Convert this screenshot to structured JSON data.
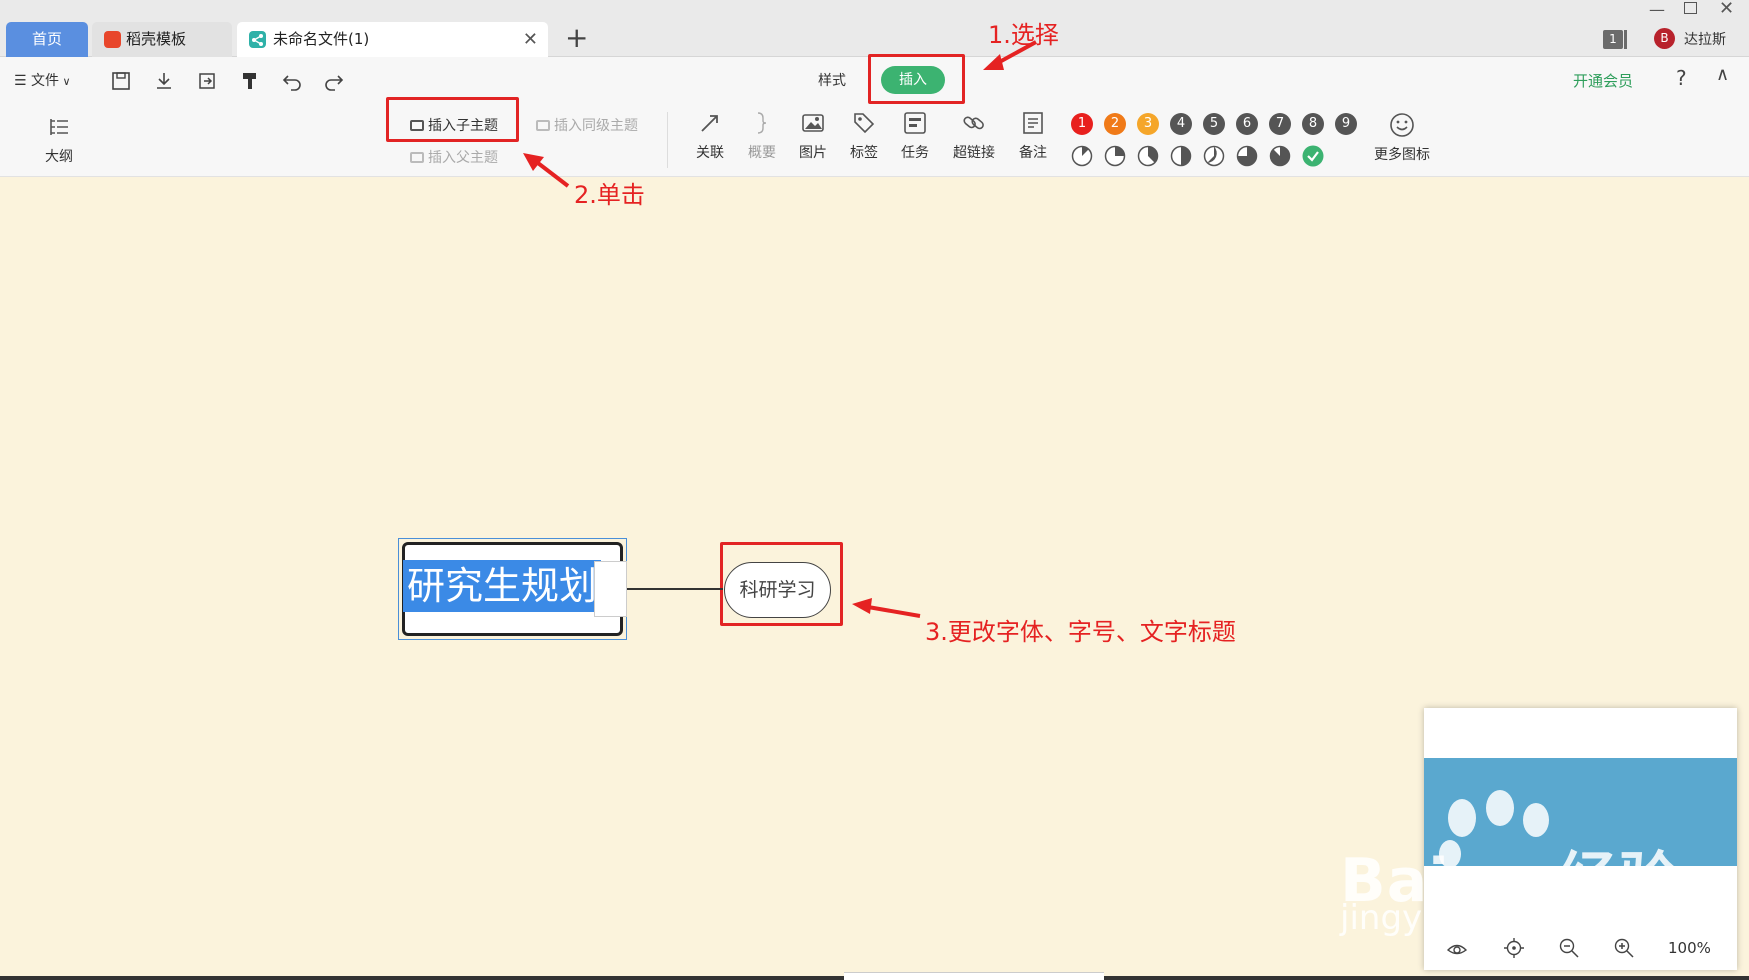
{
  "tabs": {
    "home": "首页",
    "templates": "稻壳模板",
    "file": "未命名文件(1)"
  },
  "window": {
    "page_count": "1",
    "user_name": "达拉斯",
    "user_avatar_char": "B"
  },
  "toolbar": {
    "file_menu": "文件",
    "style_tab": "样式",
    "insert_tab": "插入",
    "vip": "开通会员",
    "help": "?",
    "outline": "大纲",
    "insert_child": "插入子主题",
    "insert_sibling": "插入同级主题",
    "insert_parent": "插入父主题",
    "relation": "关联",
    "summary": "概要",
    "image": "图片",
    "tag": "标签",
    "task": "任务",
    "hyperlink": "超链接",
    "note": "备注",
    "more_icons": "更多图标",
    "priorities": [
      "1",
      "2",
      "3",
      "4",
      "5",
      "6",
      "7",
      "8",
      "9"
    ],
    "priority_colors": [
      "#e8201e",
      "#f07a18",
      "#f5a62a",
      "#555555",
      "#555555",
      "#555555",
      "#555555",
      "#555555",
      "#555555"
    ]
  },
  "annotations": {
    "step1": "1.选择",
    "step2": "2.单击",
    "step3": "3.更改字体、字号、文字标题"
  },
  "mindmap": {
    "root": "研究生规划",
    "child": "科研学习"
  },
  "minimap": {
    "zoom": "100%"
  },
  "watermark": {
    "brand": "Bai",
    "brand2": "经验",
    "url": "jingyan.baidu.com"
  },
  "colors": {
    "accent": "#3cb371",
    "annotation": "#e22424",
    "selection": "#3b8ae6",
    "canvas": "#fbf3dc"
  }
}
